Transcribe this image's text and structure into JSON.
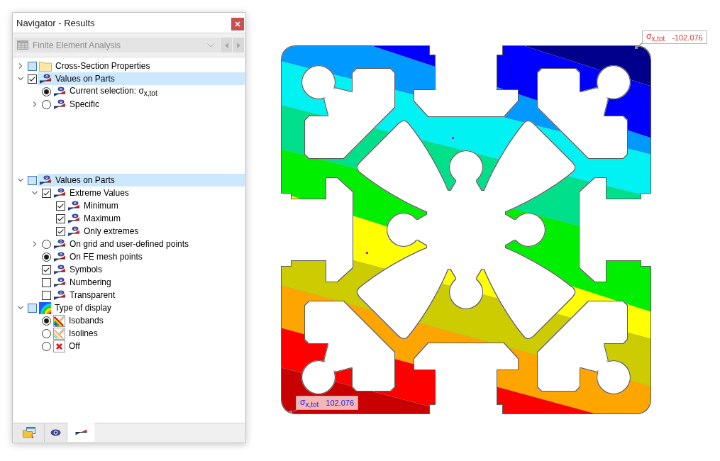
{
  "window": {
    "title": "Navigator - Results"
  },
  "toolbar": {
    "dropdown": {
      "value": "Finite Element Analysis",
      "disabled": true
    }
  },
  "panes": [
    {
      "items": [
        {
          "label": "Cross-Section Properties",
          "kind": "folder",
          "checked": false,
          "partial": true,
          "expanded": false,
          "selected": false
        },
        {
          "label": "Values on Parts",
          "kind": "result",
          "checked": true,
          "partial": false,
          "expanded": true,
          "selected": true,
          "children": [
            {
              "label": "Current selection: σ$_{x,tot}$",
              "kind": "result",
              "on": true,
              "selected": false
            },
            {
              "label": "Specific",
              "kind": "result",
              "on": false,
              "expanded": false,
              "selected": false
            }
          ]
        }
      ]
    },
    {
      "items": [
        {
          "label": "Values on Parts",
          "kind": "result",
          "checked": false,
          "partial": true,
          "expanded": true,
          "selected": true,
          "children": [
            {
              "label": "Extreme Values",
              "kind": "result",
              "checked": true,
              "partial": false,
              "expanded": true,
              "selected": false,
              "children": [
                {
                  "label": "Minimum",
                  "kind": "result",
                  "checked": true,
                  "partial": false,
                  "selected": false
                },
                {
                  "label": "Maximum",
                  "kind": "result",
                  "checked": true,
                  "partial": false,
                  "selected": false
                },
                {
                  "label": "Only extremes",
                  "kind": "result",
                  "checked": true,
                  "partial": false,
                  "selected": false
                }
              ]
            },
            {
              "label": "On grid and user-defined points",
              "kind": "result",
              "on": false,
              "expanded": false,
              "selected": false
            },
            {
              "label": "On FE mesh points",
              "kind": "result",
              "on": true,
              "selected": false
            },
            {
              "label": "Symbols",
              "kind": "result",
              "checked": true,
              "partial": false,
              "selected": false
            },
            {
              "label": "Numbering",
              "kind": "result",
              "checked": false,
              "partial": false,
              "selected": false
            },
            {
              "label": "Transparent",
              "kind": "result",
              "checked": false,
              "partial": false,
              "selected": false
            }
          ]
        },
        {
          "label": "Type of display",
          "kind": "contour",
          "checked": false,
          "partial": true,
          "expanded": true,
          "selected": false,
          "children": [
            {
              "label": "Isobands",
              "kind": "isobands",
              "on": true,
              "selected": false
            },
            {
              "label": "Isolines",
              "kind": "isolines",
              "on": false,
              "selected": false
            },
            {
              "label": "Off",
              "kind": "off",
              "on": false,
              "selected": false
            }
          ]
        }
      ]
    }
  ],
  "bottom_tabs": [
    {
      "kind": "data",
      "selected": false
    },
    {
      "kind": "display",
      "selected": false
    },
    {
      "kind": "results",
      "selected": true
    }
  ],
  "canvas": {
    "result_labels": [
      {
        "kind": "minimum",
        "symbol": "σ$_{x,tot}$",
        "value": "-102.076"
      },
      {
        "kind": "maximum",
        "symbol": "σ$_{x,tot}$",
        "value": "102.076"
      }
    ]
  }
}
